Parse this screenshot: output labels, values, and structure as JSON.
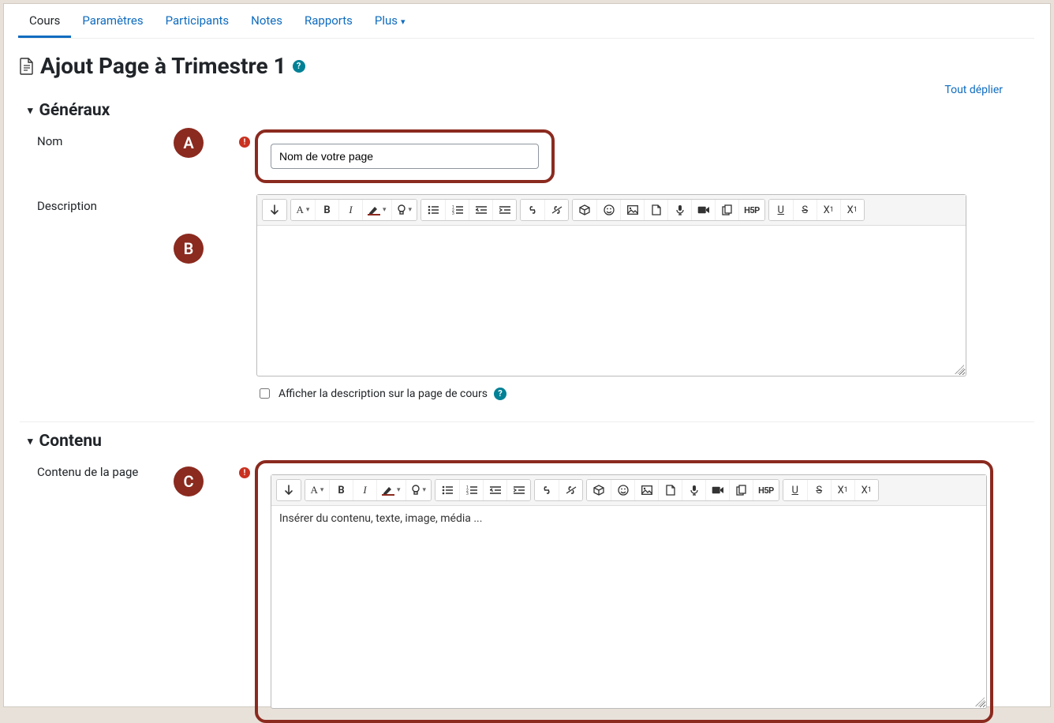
{
  "tabs": {
    "cours": "Cours",
    "parametres": "Paramètres",
    "participants": "Participants",
    "notes": "Notes",
    "rapports": "Rapports",
    "plus": "Plus"
  },
  "page_title": "Ajout Page à Trimestre 1",
  "expand_all": "Tout déplier",
  "annotations": {
    "a": "A",
    "b": "B",
    "c": "C"
  },
  "sections": {
    "generaux": {
      "heading": "Généraux",
      "nom_label": "Nom",
      "nom_value": "Nom de votre page",
      "desc_label": "Description",
      "show_desc_label": "Afficher la description sur la page de cours"
    },
    "contenu": {
      "heading": "Contenu",
      "field_label": "Contenu de la page",
      "body_text": "Insérer du contenu, texte,  image, média ..."
    }
  },
  "toolbar": {
    "expand": "↓",
    "headings": "A",
    "bold": "B",
    "italic": "I",
    "bulb": "💡",
    "h5p": "H5P",
    "underline": "U",
    "strike": "S",
    "subscript": "X",
    "superscript": "X"
  }
}
